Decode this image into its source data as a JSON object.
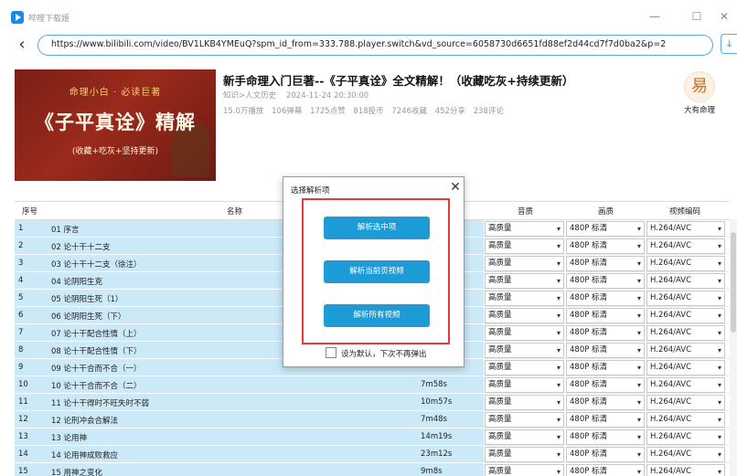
{
  "window": {
    "title": "哔哩下载姬",
    "minimize_glyph": "—",
    "maximize_glyph": "☐",
    "close_glyph": "✕"
  },
  "navigation": {
    "back_glyph": "‹",
    "url": "https://www.bilibili.com/video/BV1LKB4YMEuQ?spm_id_from=333.788.player.switch&vd_source=6058730d6651fd88ef2d44cd7f7d0ba2&p=2",
    "download_glyph": "⤓"
  },
  "video": {
    "thumbnail": {
      "top_line": "命理小白 · 必读巨著",
      "main_line": "《子平真诠》精解",
      "bottom_line": "(收藏+吃灰+坚持更新)"
    },
    "title": "新手命理入门巨著--《子平真诠》全文精解！（收藏吃灰+持续更新）",
    "category": "知识>人文历史",
    "date": "2024-11-24 20:30:00",
    "stats": [
      "15.0万播放",
      "106弹幕",
      "1725点赞",
      "818投币",
      "7246收藏",
      "452分享",
      "238评论"
    ],
    "uploader": {
      "avatar_glyph": "易",
      "name": "大有命理"
    }
  },
  "table": {
    "headers": {
      "index": "序号",
      "name": "名称",
      "audio": "音质",
      "quality": "画质",
      "codec": "视频编码"
    },
    "rows": [
      {
        "index": "1",
        "name": "01 序言",
        "duration": "",
        "audio": "高质量",
        "quality": "480P 标清",
        "codec": "H.264/AVC"
      },
      {
        "index": "2",
        "name": "02 论十干十二支",
        "duration": "",
        "audio": "高质量",
        "quality": "480P 标清",
        "codec": "H.264/AVC"
      },
      {
        "index": "3",
        "name": "03 论十干十二支（徐注）",
        "duration": "",
        "audio": "高质量",
        "quality": "480P 标清",
        "codec": "H.264/AVC"
      },
      {
        "index": "4",
        "name": "04 论阴阳生克",
        "duration": "",
        "audio": "高质量",
        "quality": "480P 标清",
        "codec": "H.264/AVC"
      },
      {
        "index": "5",
        "name": "05 论阴阳生死（1）",
        "duration": "",
        "audio": "高质量",
        "quality": "480P 标清",
        "codec": "H.264/AVC"
      },
      {
        "index": "6",
        "name": "06 论阴阳生死（下）",
        "duration": "",
        "audio": "高质量",
        "quality": "480P 标清",
        "codec": "H.264/AVC"
      },
      {
        "index": "7",
        "name": "07 论十干配合性情（上）",
        "duration": "",
        "audio": "高质量",
        "quality": "480P 标清",
        "codec": "H.264/AVC"
      },
      {
        "index": "8",
        "name": "08 论十干配合性情（下）",
        "duration": "",
        "audio": "高质量",
        "quality": "480P 标清",
        "codec": "H.264/AVC"
      },
      {
        "index": "9",
        "name": "09 论十干合而不合（一）",
        "duration": "",
        "audio": "高质量",
        "quality": "480P 标清",
        "codec": "H.264/AVC"
      },
      {
        "index": "10",
        "name": "10 论十干合而不合（二）",
        "duration": "7m58s",
        "audio": "高质量",
        "quality": "480P 标清",
        "codec": "H.264/AVC"
      },
      {
        "index": "11",
        "name": "11 论十干得时不旺失时不弱",
        "duration": "10m57s",
        "audio": "高质量",
        "quality": "480P 标清",
        "codec": "H.264/AVC"
      },
      {
        "index": "12",
        "name": "12 论刑冲会合解法",
        "duration": "7m48s",
        "audio": "高质量",
        "quality": "480P 标清",
        "codec": "H.264/AVC"
      },
      {
        "index": "13",
        "name": "13 论用神",
        "duration": "14m19s",
        "audio": "高质量",
        "quality": "480P 标清",
        "codec": "H.264/AVC"
      },
      {
        "index": "14",
        "name": "14 论用神成败救应",
        "duration": "23m12s",
        "audio": "高质量",
        "quality": "480P 标清",
        "codec": "H.264/AVC"
      },
      {
        "index": "15",
        "name": "15 用神之变化",
        "duration": "9m8s",
        "audio": "高质量",
        "quality": "480P 标清",
        "codec": "H.264/AVC"
      }
    ]
  },
  "dialog": {
    "title": "选择解析项",
    "close_glyph": "✕",
    "buttons": {
      "parse_selected": "解析选中项",
      "parse_current_page": "解析当前页视频",
      "parse_all": "解析所有视频"
    },
    "checkbox_label": "设为默认，下次不再弹出",
    "frame_color": "#e8383d",
    "button_color": "#1d9bd6"
  }
}
